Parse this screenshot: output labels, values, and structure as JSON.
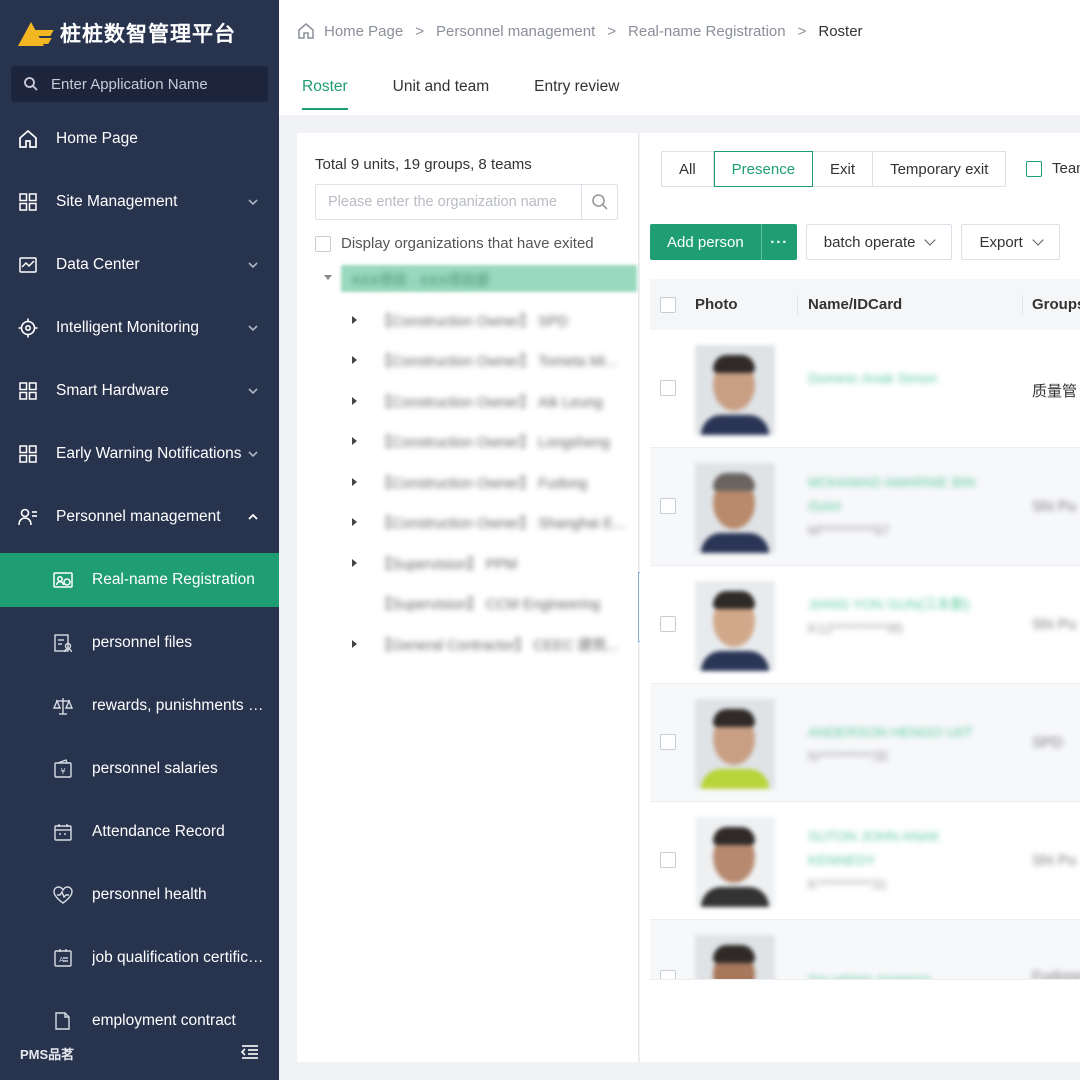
{
  "app": {
    "title": "桩桩数智管理平台",
    "brand": "PMS品茗",
    "app_search_placeholder": "Enter Application Name"
  },
  "sidebar": {
    "menu": [
      {
        "label": "Home Page",
        "icon": "home-icon"
      },
      {
        "label": "Site Management",
        "icon": "grid-icon"
      },
      {
        "label": "Data Center",
        "icon": "chart-icon"
      },
      {
        "label": "Intelligent Monitoring",
        "icon": "target-icon"
      },
      {
        "label": "Smart Hardware",
        "icon": "grid-icon"
      },
      {
        "label": "Early Warning Notifications",
        "icon": "grid-icon"
      },
      {
        "label": "Personnel management",
        "icon": "user-list-icon"
      }
    ],
    "submenu": [
      {
        "label": "Real-name Registration",
        "icon": "id-card-icon",
        "active": true
      },
      {
        "label": "personnel files",
        "icon": "file-user-icon"
      },
      {
        "label": "rewards, punishments and incentives",
        "icon": "scale-icon"
      },
      {
        "label": "personnel salaries",
        "icon": "wallet-icon"
      },
      {
        "label": "Attendance Record",
        "icon": "calendar-icon"
      },
      {
        "label": "personnel health",
        "icon": "heart-icon"
      },
      {
        "label": "job qualification certificate",
        "icon": "certificate-icon"
      },
      {
        "label": "employment contract",
        "icon": "contract-icon"
      }
    ]
  },
  "breadcrumb": [
    "Home Page",
    "Personnel management",
    "Real-name Registration",
    "Roster"
  ],
  "tabs": [
    {
      "label": "Roster",
      "active": true
    },
    {
      "label": "Unit and team"
    },
    {
      "label": "Entry review"
    }
  ],
  "org": {
    "summary": "Total 9 units, 19 groups, 8 teams",
    "search_placeholder": "Please enter the organization name",
    "show_exited_label": "Display organizations that have exited",
    "root": "XXX项目 - XXX项目部",
    "nodes": [
      {
        "label": "【Construction Owner】 SPD",
        "expandable": true
      },
      {
        "label": "【Construction Owner】 Tometa Mi...",
        "expandable": true
      },
      {
        "label": "【Construction Owner】 Aik Leung",
        "expandable": true
      },
      {
        "label": "【Construction Owner】 Longsheng",
        "expandable": true
      },
      {
        "label": "【Construction Owner】 Fudong",
        "expandable": true
      },
      {
        "label": "【Construction Owner】 Shanghai E...",
        "expandable": true
      },
      {
        "label": "【Supervision】 PPM",
        "expandable": true
      },
      {
        "label": "【Supervision】 CCM Engineering",
        "expandable": false
      },
      {
        "label": "【General Contractor】 CEEC 建筑...",
        "expandable": true
      }
    ]
  },
  "filters": {
    "status": [
      {
        "label": "All"
      },
      {
        "label": "Presence",
        "active": true
      },
      {
        "label": "Exit"
      },
      {
        "label": "Temporary exit"
      }
    ],
    "team_label": "Team"
  },
  "actions": {
    "add_person": "Add person",
    "more": "···",
    "batch_operate": "batch operate",
    "export": "Export"
  },
  "table": {
    "headers": {
      "photo": "Photo",
      "name": "Name/IDCard",
      "groups": "Groups"
    },
    "rows": [
      {
        "name": "Dominic Anak Simon",
        "id": "",
        "group": "质量管",
        "group_blur": false
      },
      {
        "name": "MOHAMAD AMARNIE BIN ISAH",
        "id": "M**********97",
        "group": "Shi Pu",
        "group_blur": true
      },
      {
        "name": "JIANG YON GUN(江永勤)",
        "id": "K12**********95",
        "group": "Shi Pu",
        "group_blur": true
      },
      {
        "name": "ANDERSON HENGO UIIT",
        "id": "N**********35",
        "group": "SPD",
        "group_blur": true,
        "vest": true
      },
      {
        "name": "SUTON JOHN ANAK KENNEDY",
        "id": "K**********31",
        "group": "Shi Pu",
        "group_blur": true
      },
      {
        "name": "TAI HENG SIANGG",
        "id": "",
        "group": "Fudong",
        "group_blur": true
      }
    ]
  },
  "colors": {
    "accent": "#1f9e73",
    "sidebar_bg": "#28334e"
  }
}
